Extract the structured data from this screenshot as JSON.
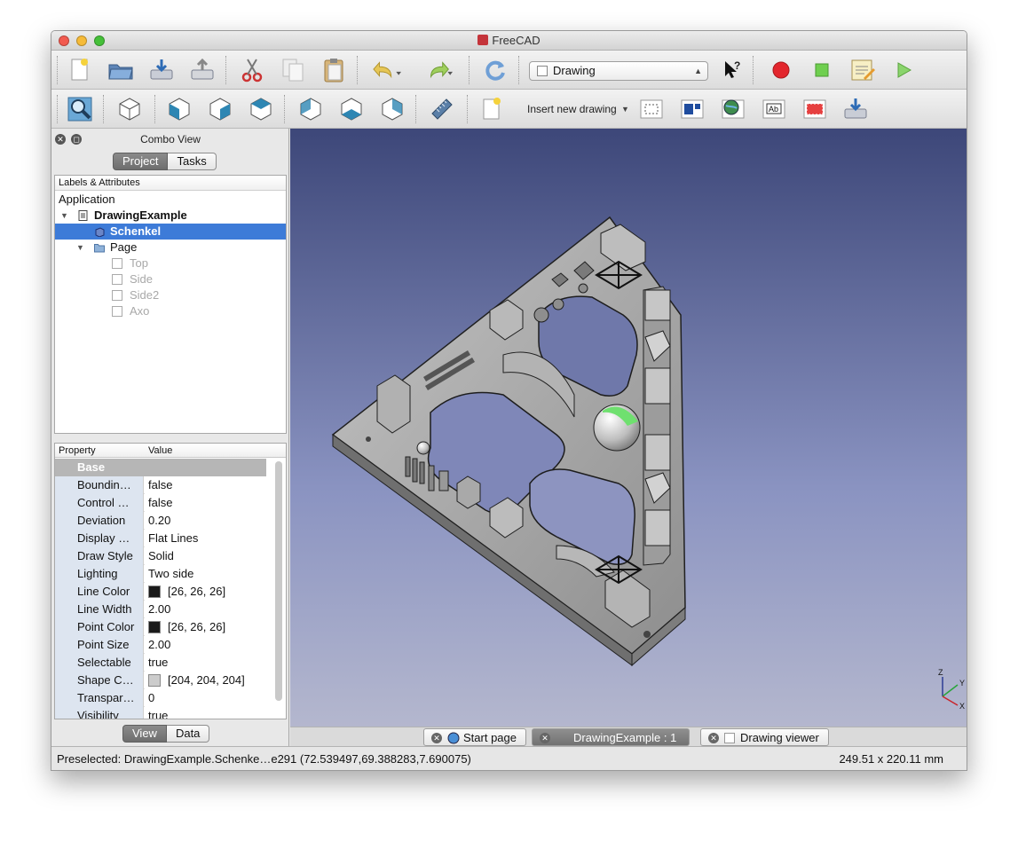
{
  "window": {
    "title": "FreeCAD"
  },
  "toolbar": {
    "workbench_selected": "Drawing",
    "insert_drawing_label": "Insert new drawing"
  },
  "combo_view": {
    "title": "Combo View",
    "tabs": [
      "Project",
      "Tasks"
    ],
    "active_tab": "Project"
  },
  "tree": {
    "header": "Labels & Attributes",
    "root": "Application",
    "document": "DrawingExample",
    "selected": "Schenkel",
    "page": "Page",
    "views": [
      "Top",
      "Side",
      "Side2",
      "Axo"
    ]
  },
  "properties": {
    "col_property": "Property",
    "col_value": "Value",
    "group": "Base",
    "rows": [
      {
        "name": "Boundin…",
        "value": "false"
      },
      {
        "name": "Control …",
        "value": "false"
      },
      {
        "name": "Deviation",
        "value": "0.20"
      },
      {
        "name": "Display …",
        "value": "Flat Lines"
      },
      {
        "name": "Draw Style",
        "value": "Solid"
      },
      {
        "name": "Lighting",
        "value": "Two side"
      },
      {
        "name": "Line Color",
        "value": "[26, 26, 26]",
        "swatch": "#1a1a1a"
      },
      {
        "name": "Line Width",
        "value": "2.00"
      },
      {
        "name": "Point Color",
        "value": "[26, 26, 26]",
        "swatch": "#1a1a1a"
      },
      {
        "name": "Point Size",
        "value": "2.00"
      },
      {
        "name": "Selectable",
        "value": "true"
      },
      {
        "name": "Shape C…",
        "value": "[204, 204, 204]",
        "swatch": "#cccccc"
      },
      {
        "name": "Transpar…",
        "value": "0"
      },
      {
        "name": "Visibility",
        "value": "true"
      }
    ],
    "tabs": [
      "View",
      "Data"
    ],
    "active_tab": "View"
  },
  "doc_tabs": [
    "Start page",
    "DrawingExample : 1",
    "Drawing viewer"
  ],
  "active_doc_tab": "DrawingExample : 1",
  "status": {
    "preselected": "Preselected: DrawingExample.Schenke…e291 (72.539497,69.388283,7.690075)",
    "dimensions": "249.51 x 220.11 mm"
  },
  "axis": {
    "z": "Z",
    "y": "Y",
    "x": "X"
  },
  "colors": {
    "selection": "#3d7bd8",
    "viewport_top": "#3d4779",
    "viewport_bottom": "#b4b7ce",
    "part_gray": "#a9a9a9",
    "highlight_green": "#6fe06f"
  }
}
